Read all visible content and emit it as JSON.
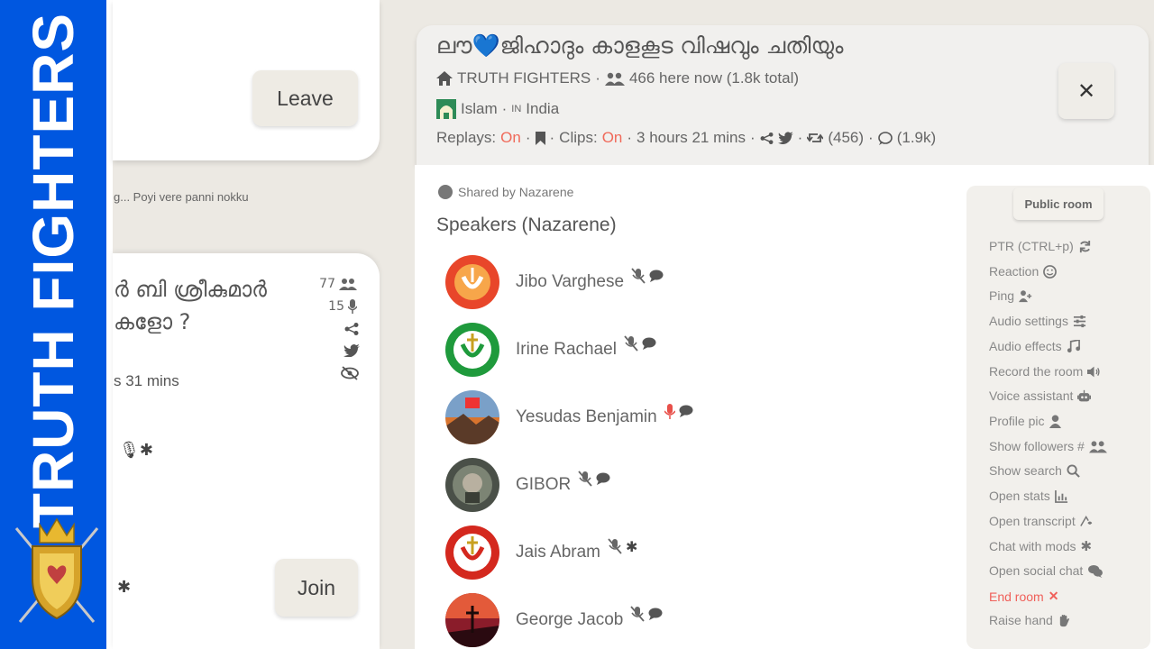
{
  "brand": {
    "text": "TRUTH FIGHTERS"
  },
  "left": {
    "card_a": {
      "leave_label": "Leave"
    },
    "snippet": "g... Poyi vere panni nokku",
    "card_b": {
      "title_line1": "ർ ബി ശ്രീകുമാർ",
      "title_line2": "കളോ ?",
      "listeners": "77",
      "speakers": "15",
      "time": "s 31 mins",
      "join_label": "Join"
    }
  },
  "room": {
    "title": "ലൗ💙ജിഹാദും കാളകൂട വിഷവും ചതിയും",
    "club": "TRUTH FIGHTERS",
    "here_now": "466 here now (1.8k total)",
    "topic": "Islam",
    "country_code": "IN",
    "country": "India",
    "replays_label": "Replays:",
    "replays_value": "On",
    "clips_label": "Clips:",
    "clips_value": "On",
    "duration": "3 hours 21 mins",
    "retweets": "(456)",
    "comments": "(1.9k)",
    "shared_by": "Shared by Nazarene",
    "speakers_heading": "Speakers (Nazarene)"
  },
  "speakers": [
    {
      "name": "Jibo Varghese",
      "mic": "muted",
      "extra": "chat"
    },
    {
      "name": "Irine Rachael",
      "mic": "muted",
      "extra": "chat"
    },
    {
      "name": "Yesudas Benjamin",
      "mic": "live",
      "extra": "chat"
    },
    {
      "name": "GIBOR",
      "mic": "muted",
      "extra": "chat"
    },
    {
      "name": "Jais Abram",
      "mic": "muted",
      "extra": "asterisk"
    },
    {
      "name": "George Jacob",
      "mic": "muted",
      "extra": "chat"
    }
  ],
  "menu": {
    "public_room": "Public room",
    "items": [
      {
        "label": "PTR (CTRL+p)",
        "icon": "refresh-icon"
      },
      {
        "label": "Reaction",
        "icon": "emoji-icon"
      },
      {
        "label": "Ping",
        "icon": "user-plus-icon"
      },
      {
        "label": "Audio settings",
        "icon": "sliders-icon"
      },
      {
        "label": "Audio effects",
        "icon": "music-icon"
      },
      {
        "label": "Record the room",
        "icon": "volume-icon"
      },
      {
        "label": "Voice assistant",
        "icon": "robot-icon"
      },
      {
        "label": "Profile pic",
        "icon": "user-icon"
      },
      {
        "label": "Show followers #",
        "icon": "users-icon"
      },
      {
        "label": "Show search",
        "icon": "search-icon"
      },
      {
        "label": "Open stats",
        "icon": "chart-icon"
      },
      {
        "label": "Open transcript",
        "icon": "transcript-icon"
      },
      {
        "label": "Chat with mods",
        "icon": "asterisk-icon"
      },
      {
        "label": "Open social chat",
        "icon": "chats-icon"
      },
      {
        "label": "End room",
        "icon": "close-icon"
      },
      {
        "label": "Raise hand",
        "icon": "hand-icon"
      }
    ]
  },
  "colors": {
    "brand_blue": "#0057e0",
    "accent_red": "#f06a5a",
    "panel": "#f1f0ee"
  }
}
